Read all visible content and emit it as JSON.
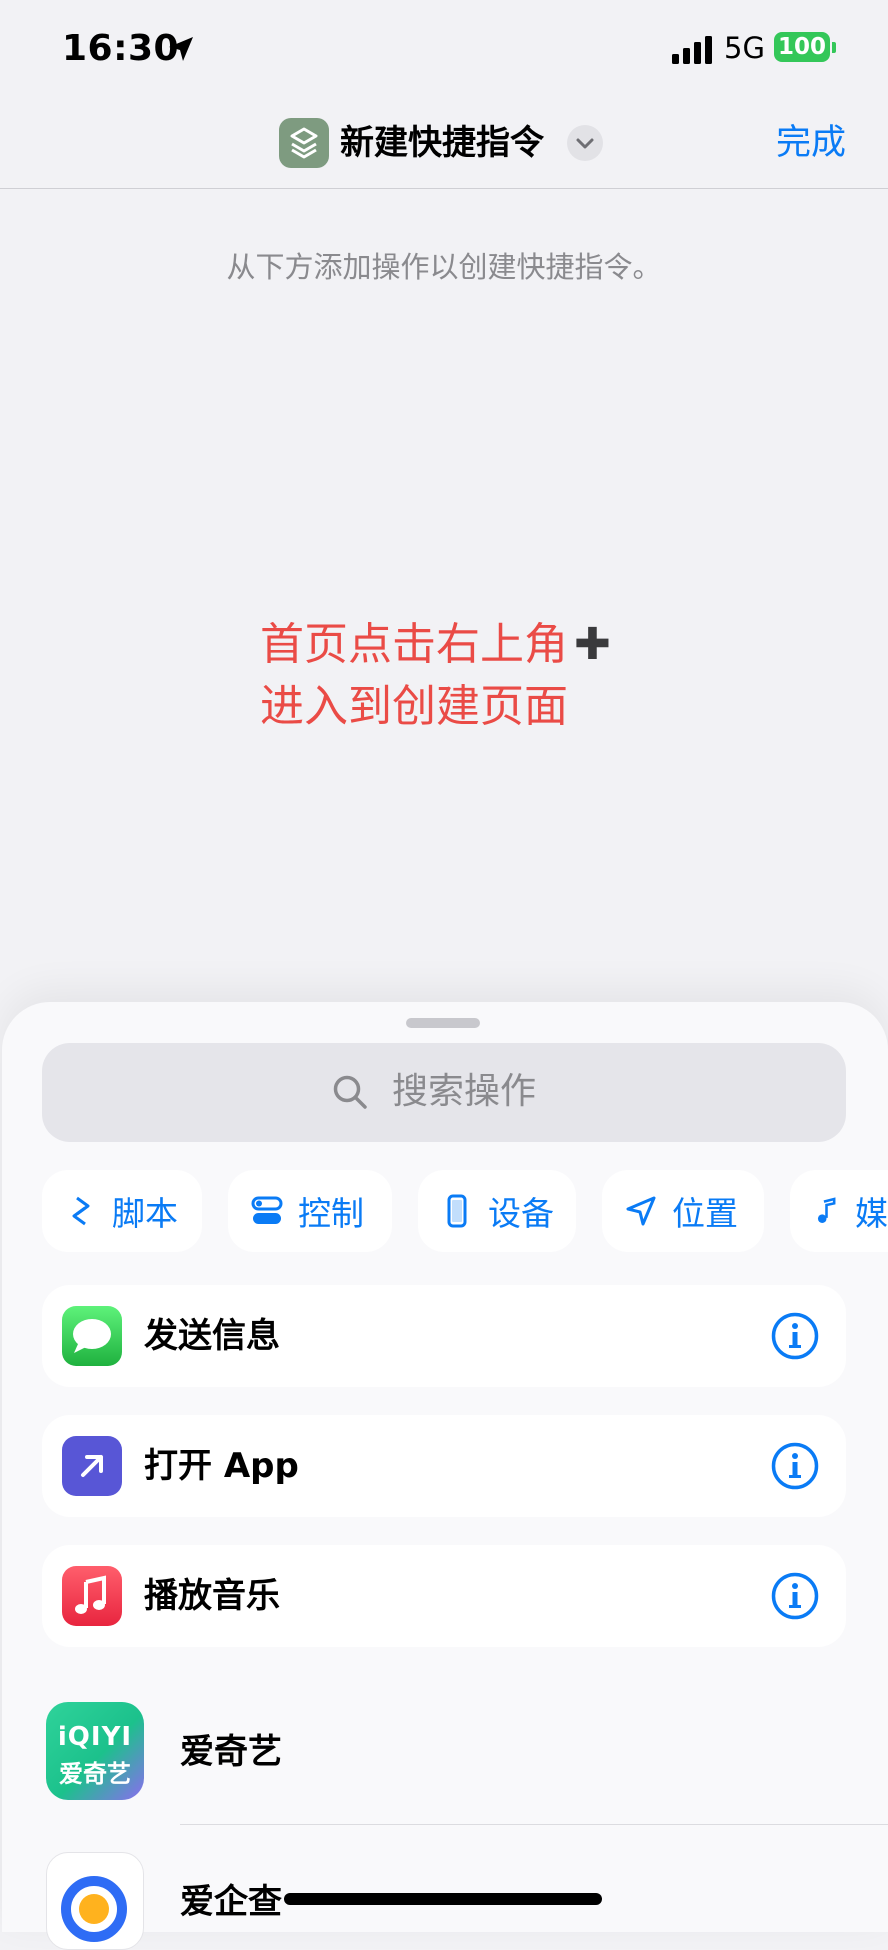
{
  "status_bar": {
    "time": "16:30",
    "network": "5G",
    "battery": "100"
  },
  "nav": {
    "title": "新建快捷指令",
    "done_label": "完成"
  },
  "hint": "从下方添加操作以创建快捷指令。",
  "overlay": {
    "line1": "首页点击右上角",
    "plus": "✚",
    "line2": "进入到创建页面"
  },
  "search": {
    "placeholder": "搜索操作"
  },
  "categories": [
    {
      "label": "脚本",
      "icon": "script-icon"
    },
    {
      "label": "控制",
      "icon": "toggle-icon"
    },
    {
      "label": "设备",
      "icon": "phone-icon"
    },
    {
      "label": "位置",
      "icon": "location-arrow-icon"
    },
    {
      "label": "媒",
      "icon": "music-note-icon"
    }
  ],
  "actions": [
    {
      "label": "发送信息",
      "icon": "messages-icon",
      "color": "#34c759"
    },
    {
      "label": "打开 App",
      "icon": "open-app-arrow-icon",
      "color": "#5856d6"
    },
    {
      "label": "播放音乐",
      "icon": "music-icon",
      "color": "#fc3c44"
    }
  ],
  "apps": [
    {
      "label": "爱奇艺",
      "icon_text_1": "iQIYI",
      "icon_text_2": "爱奇艺"
    },
    {
      "label": "爱企查"
    }
  ],
  "colors": {
    "accent": "#0a7bf5",
    "overlay_text": "#ea4b46",
    "info": "#0a7bf5"
  }
}
